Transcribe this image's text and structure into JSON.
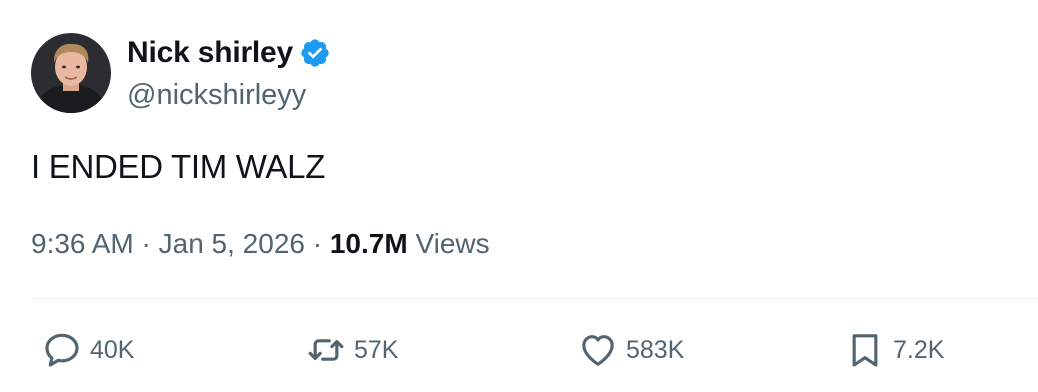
{
  "author": {
    "display_name": "Nick shirley",
    "handle": "@nickshirleyy",
    "verified": true,
    "verified_color": "#1d9bf0",
    "avatar_icon": "profile-photo"
  },
  "tweet": {
    "text": "I ENDED TIM WALZ",
    "time": "9:36 AM",
    "separator": "·",
    "date": "Jan 5, 2026",
    "views_count": "10.7M",
    "views_label": "Views"
  },
  "actions": {
    "reply": {
      "icon": "reply-icon",
      "count": "40K"
    },
    "repost": {
      "icon": "repost-icon",
      "count": "57K"
    },
    "like": {
      "icon": "heart-icon",
      "count": "583K"
    },
    "bookmark": {
      "icon": "bookmark-icon",
      "count": "7.2K"
    }
  },
  "colors": {
    "text_primary": "#0f1419",
    "text_secondary": "#536471",
    "divider": "#eff3f4"
  }
}
